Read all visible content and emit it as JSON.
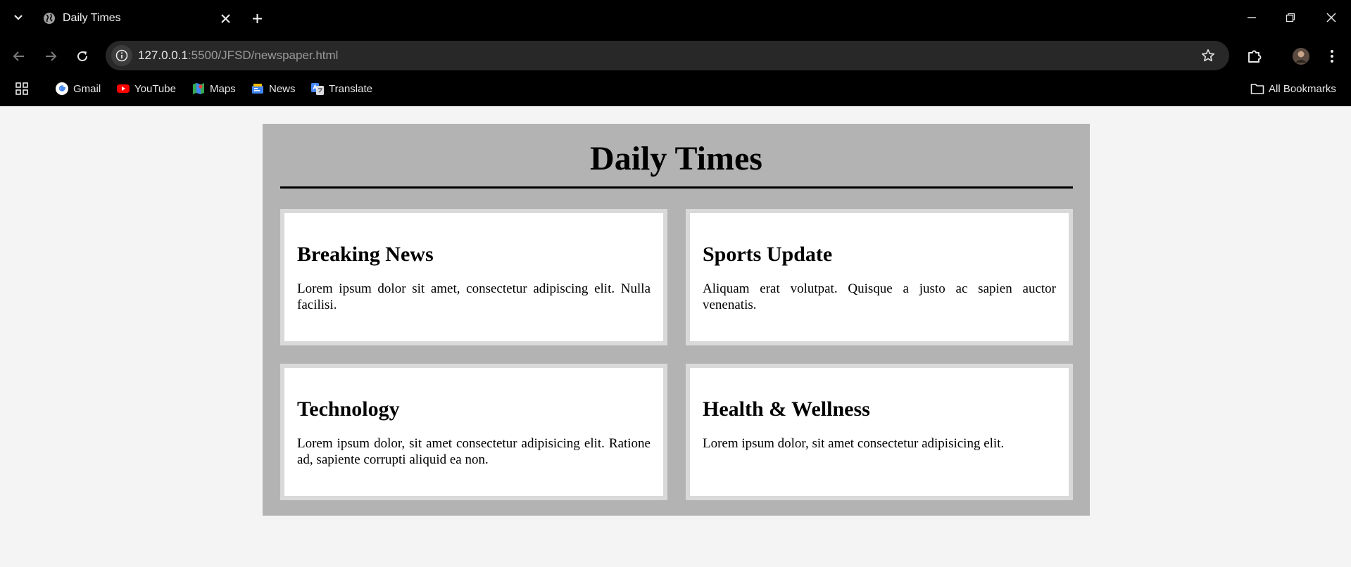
{
  "browser": {
    "tab": {
      "title": "Daily Times"
    },
    "address": {
      "url_host": "127.0.0.1",
      "url_rest": ":5500/JFSD/newspaper.html"
    },
    "bookmarks": [
      {
        "label": "Gmail",
        "icon": "gmail-icon"
      },
      {
        "label": "YouTube",
        "icon": "youtube-icon"
      },
      {
        "label": "Maps",
        "icon": "maps-icon"
      },
      {
        "label": "News",
        "icon": "news-icon"
      },
      {
        "label": "Translate",
        "icon": "translate-icon"
      }
    ],
    "all_bookmarks_label": "All Bookmarks"
  },
  "page": {
    "title": "Daily Times",
    "articles": [
      {
        "heading": "Breaking News",
        "body": "Lorem ipsum dolor sit amet, consectetur adipiscing elit. Nulla facilisi."
      },
      {
        "heading": "Sports Update",
        "body": "Aliquam erat volutpat. Quisque a justo ac sapien auctor venenatis."
      },
      {
        "heading": "Technology",
        "body": "Lorem ipsum dolor, sit amet consectetur adipisicing elit. Ratione ad, sapiente corrupti aliquid ea non."
      },
      {
        "heading": "Health & Wellness",
        "body": "Lorem ipsum dolor, sit amet consectetur adipisicing elit."
      }
    ]
  },
  "colors": {
    "page_bg": "#f4f4f4",
    "paper_bg": "#b4b3b4",
    "card_border": "#d9d9d9",
    "chrome_bg": "#000000"
  }
}
